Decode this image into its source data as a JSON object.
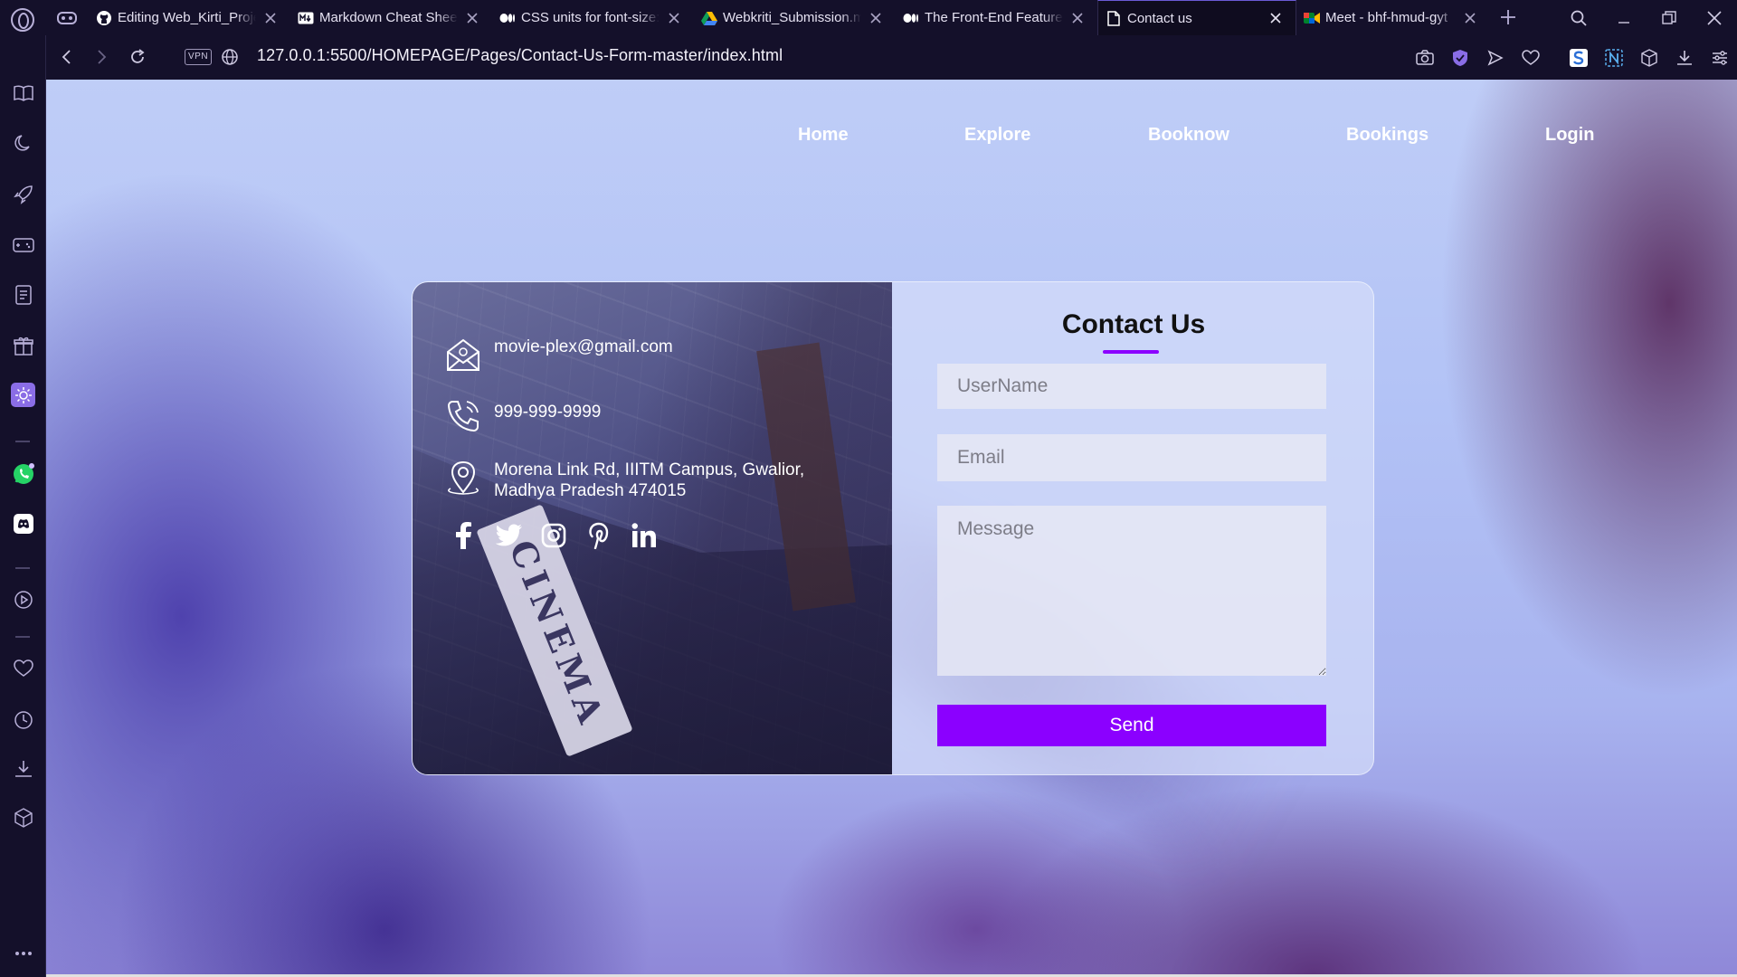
{
  "browser": {
    "tabs": [
      {
        "title": "Editing Web_Kirti_Proje",
        "icon": "github-icon"
      },
      {
        "title": "Markdown Cheat Sheet",
        "icon": "markdown-icon"
      },
      {
        "title": "CSS units for font-size:",
        "icon": "medium-icon"
      },
      {
        "title": "Webkriti_Submission.m",
        "icon": "google-drive-icon"
      },
      {
        "title": "The Front-End Features",
        "icon": "medium-icon"
      },
      {
        "title": "Contact us",
        "icon": "document-icon",
        "active": true
      },
      {
        "title": "Meet - bhf-hmud-gyt",
        "icon": "google-meet-icon"
      }
    ],
    "address": {
      "vpn_label": "VPN",
      "url": "127.0.0.1:5500/HOMEPAGE/Pages/Contact-Us-Form-master/index.html"
    }
  },
  "site": {
    "nav": [
      "Home",
      "Explore",
      "Booknow",
      "Bookings",
      "Login"
    ],
    "contact": {
      "email": "movie-plex@gmail.com",
      "phone": "999-999-9999",
      "address_line1": "Morena Link Rd, IIITM Campus, Gwalior,",
      "address_line2": "Madhya Pradesh 474015",
      "sign_text": "CINEMA",
      "socials": [
        "facebook-icon",
        "twitter-icon",
        "instagram-icon",
        "pinterest-icon",
        "linkedin-icon"
      ]
    },
    "form": {
      "title": "Contact Us",
      "username_placeholder": "UserName",
      "email_placeholder": "Email",
      "message_placeholder": "Message",
      "send_label": "Send"
    }
  },
  "colors": {
    "accent": "#8b00ff",
    "browser_chrome": "#14102a"
  }
}
